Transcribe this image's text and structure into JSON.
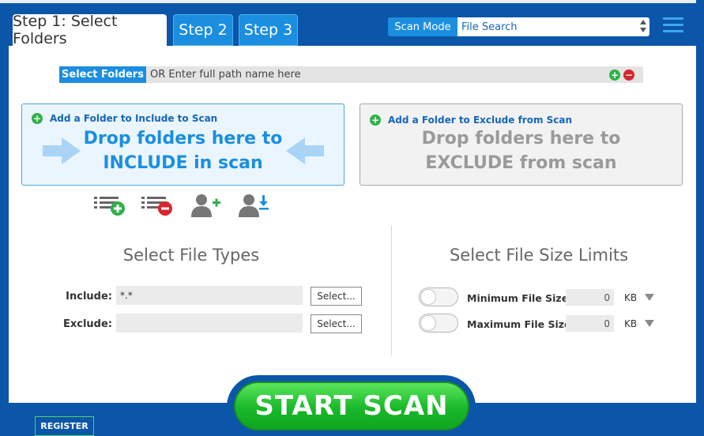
{
  "tabs": [
    {
      "label": "Step 1: Select Folders",
      "active": true
    },
    {
      "label": "Step 2",
      "active": false
    },
    {
      "label": "Step 3",
      "active": false
    }
  ],
  "scan_mode": {
    "label": "Scan Mode",
    "value": "File Search"
  },
  "menu_icon": "hamburger-menu-icon",
  "path": {
    "button_label": "Select Folders",
    "placeholder": "OR Enter full path name here",
    "add_icon": "plus-circle-icon",
    "remove_icon": "minus-circle-icon"
  },
  "include_zone": {
    "header": "Add a Folder to Include to Scan",
    "line1": "Drop folders here to",
    "line2": "INCLUDE in scan"
  },
  "exclude_zone": {
    "header": "Add a Folder to Exclude from Scan",
    "line1": "Drop folders here to",
    "line2": "EXCLUDE from scan"
  },
  "toolbar_icons": [
    "list-add-icon",
    "list-remove-icon",
    "user-add-icon",
    "user-download-icon"
  ],
  "file_types": {
    "title": "Select File Types",
    "include_label": "Include:",
    "include_value": "*.*",
    "exclude_label": "Exclude:",
    "exclude_value": "",
    "select_label": "Select..."
  },
  "file_size": {
    "title": "Select File Size Limits",
    "min_label": "Minimum File Size",
    "min_value": "0",
    "max_label": "Maximum File Size",
    "max_value": "0",
    "unit": "KB"
  },
  "start_button": "START  SCAN",
  "register_button": "REGISTER",
  "colors": {
    "accent": "#1b8ee0",
    "header": "#0b56a8",
    "start": "#19b82a"
  }
}
